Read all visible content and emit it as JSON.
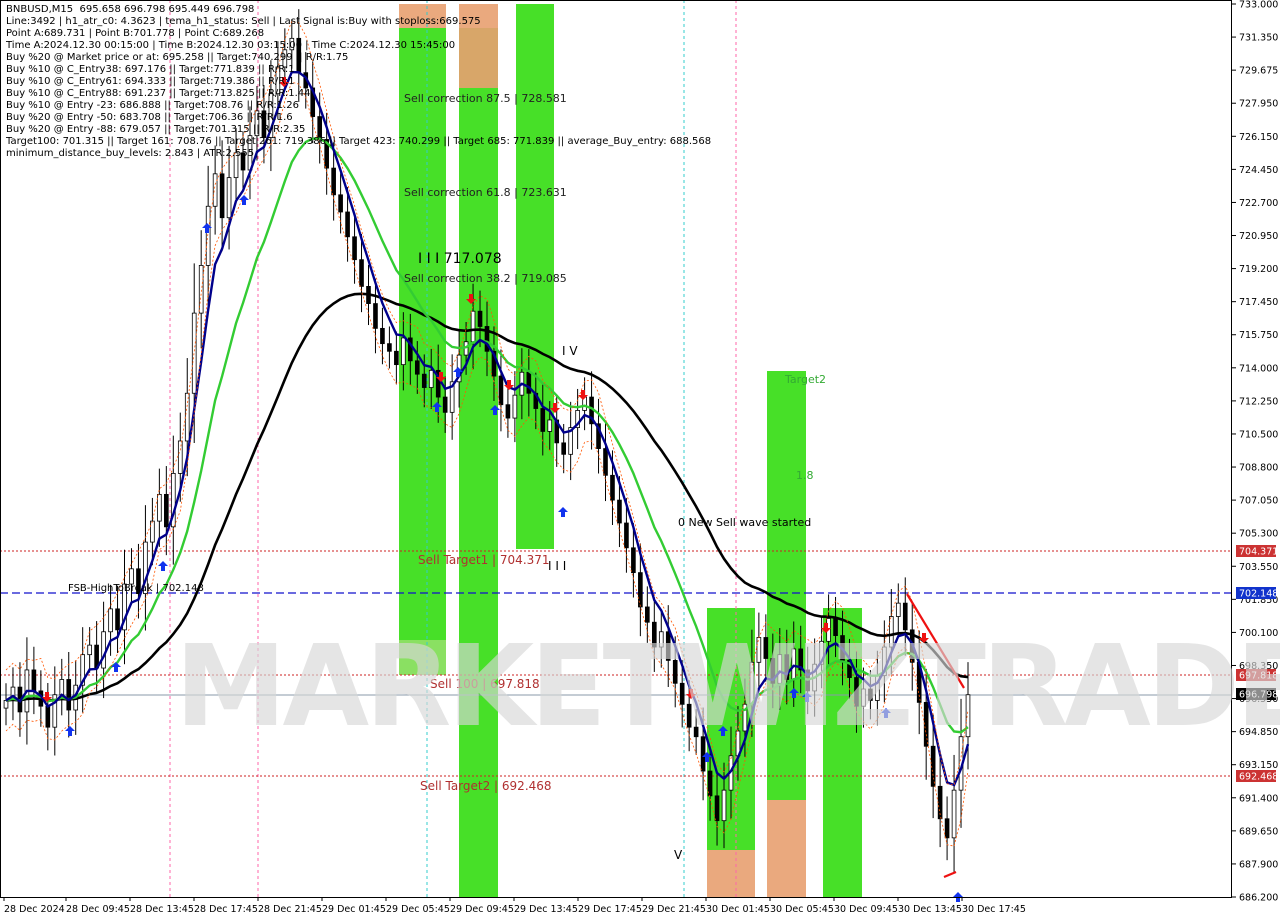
{
  "header": {
    "symbol": "BNBUSD,M15",
    "ohlc": "695.658 696.798 695.449 696.798",
    "lines": [
      "Line:3492 | h1_atr_c0: 4.3623 | tema_h1_status: Sell | Last Signal is:Buy with stoploss:669.575",
      "Point A:689.731 | Point B:701.778 | Point C:689.268",
      "Time A:2024.12.30 00:15:00 | Time B:2024.12.30 03:15:00 | Time C:2024.12.30 15:45:00",
      "Buy %20 @ Market price or at: 695.258 || Target:740.299 || R/R:1.75",
      "Buy %10 @ C_Entry38: 697.176 || Target:771.839 || R/R:1",
      "Buy %10 @ C_Entry61: 694.333 || Target:719.386 || R/R:1",
      "Buy %10 @ C_Entry88: 691.237 || Target:713.825 || R/R:1.44",
      "Buy %10 @ Entry -23: 686.888 || Target:708.76 || R/R:1.26",
      "Buy %20 @ Entry -50: 683.708 || Target:706.36 || R/R:1.6",
      "Buy %20 @ Entry -88: 679.057 || Target:701.315 || R/R:2.35",
      "Target100: 701.315 || Target 161: 708.76 || Target 261: 719.386 || Target 423: 740.299 || Target 685: 771.839 || average_Buy_entry: 688.568",
      "minimum_distance_buy_levels: 2.843 | ATR:2.555"
    ]
  },
  "watermark": "MARKETWIZTRADE",
  "price_labels": {
    "current": "696.798",
    "sell_target1": "704.371",
    "fsb_high": "702.148",
    "sell100": "697.818",
    "sell_target2": "692.468"
  },
  "annotations": {
    "sell_corr_875": "Sell correction 87.5 | 728.581",
    "sell_corr_618": "Sell correction 61.8 | 723.631",
    "sell_corr_382": "Sell correction 38.2 | 719.085",
    "level_717": "I I I 717.078",
    "wave_iv": "I V",
    "wave_v": "V",
    "wave_iii": "I I I",
    "sell_target1": "Sell Target1 | 704.371",
    "sell100": "Sell 100 | 697.818",
    "sell_target2": "Sell Target2 | 692.468",
    "fsb": "FSB-HighToBreak | 702.148",
    "target2": "Target2",
    "t18": "1.8",
    "new_wave": "0 New Sell wave started"
  },
  "colors": {
    "green": "#33dd11",
    "orange": "#e8a070",
    "navy": "#00008b",
    "ma_green": "#33cc33",
    "red_level": "#cc2222",
    "blue_level": "#1111cc"
  },
  "chart_data": {
    "type": "candlestick",
    "title": "BNBUSD,M15",
    "ylim": [
      686.2,
      733.0
    ],
    "y_ticks": [
      "733.000",
      "731.350",
      "729.675",
      "727.950",
      "726.150",
      "724.450",
      "722.700",
      "720.950",
      "719.200",
      "717.450",
      "715.750",
      "714.000",
      "712.250",
      "710.500",
      "708.800",
      "707.050",
      "705.300",
      "703.550",
      "701.850",
      "700.100",
      "698.350",
      "696.550",
      "694.850",
      "693.150",
      "691.400",
      "689.650",
      "687.900",
      "686.200"
    ],
    "x_ticks": [
      "28 Dec 2024",
      "28 Dec 09:45",
      "28 Dec 13:45",
      "28 Dec 17:45",
      "28 Dec 21:45",
      "29 Dec 01:45",
      "29 Dec 05:45",
      "29 Dec 09:45",
      "29 Dec 13:45",
      "29 Dec 17:45",
      "29 Dec 21:45",
      "30 Dec 01:45",
      "30 Dec 05:45",
      "30 Dec 09:45",
      "30 Dec 13:45",
      "30 Dec 17:45"
    ],
    "close": [
      696.5,
      697.2,
      695.9,
      698.1,
      697.0,
      696.2,
      695.1,
      696.8,
      697.6,
      696.0,
      697.3,
      698.9,
      699.4,
      698.2,
      700.1,
      701.3,
      700.2,
      702.6,
      703.4,
      702.1,
      704.8,
      705.9,
      707.3,
      705.6,
      708.4,
      710.1,
      712.6,
      716.8,
      719.3,
      722.4,
      724.1,
      721.8,
      723.9,
      725.2,
      724.3,
      726.1,
      727.4,
      726.0,
      728.3,
      729.7,
      730.6,
      731.2,
      729.4,
      728.6,
      727.1,
      725.9,
      724.4,
      723.0,
      722.1,
      720.8,
      719.6,
      718.2,
      717.3,
      716.0,
      715.2,
      714.8,
      714.1,
      715.5,
      714.3,
      713.6,
      712.9,
      713.8,
      712.4,
      711.6,
      713.2,
      714.6,
      715.3,
      716.9,
      716.1,
      714.8,
      713.5,
      712.0,
      711.3,
      712.5,
      713.7,
      712.6,
      711.8,
      710.6,
      711.2,
      710.0,
      709.4,
      710.8,
      711.7,
      712.4,
      711.0,
      709.7,
      708.3,
      707.0,
      705.8,
      704.5,
      703.2,
      701.4,
      700.6,
      699.3,
      700.1,
      698.6,
      697.4,
      696.3,
      695.1,
      694.6,
      692.8,
      691.5,
      690.2,
      691.8,
      693.6,
      694.9,
      696.3,
      698.5,
      699.8,
      698.7,
      697.4,
      698.9,
      697.6,
      699.2,
      698.1,
      697.0,
      698.4,
      699.6,
      700.8,
      699.9,
      698.6,
      697.7,
      696.2,
      697.1,
      696.5,
      697.8,
      699.3,
      700.9,
      701.6,
      700.2,
      698.5,
      696.4,
      694.1,
      692.0,
      690.3,
      689.3,
      691.8,
      694.6,
      696.8
    ]
  }
}
